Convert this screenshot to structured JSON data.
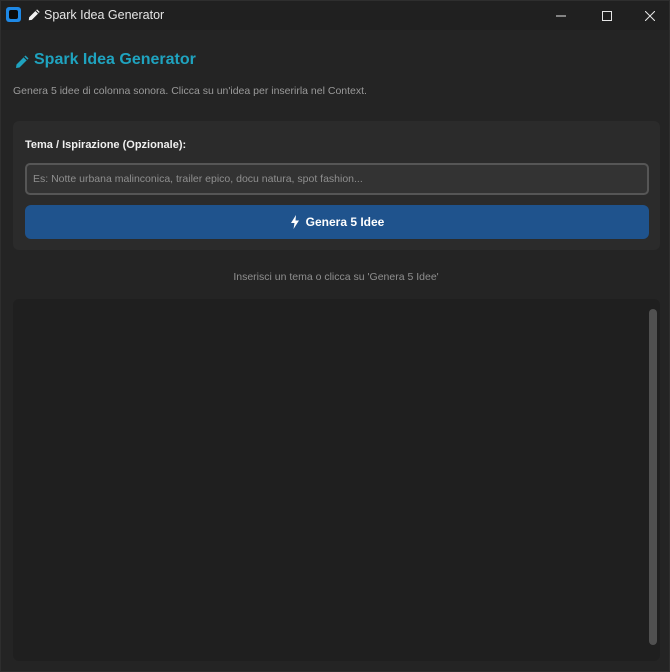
{
  "window": {
    "title": "Spark Idea Generator",
    "minimize_icon": "minimize-icon",
    "maximize_icon": "maximize-icon",
    "close_icon": "close-icon"
  },
  "header": {
    "icon": "pencil-icon",
    "title": "Spark Idea Generator",
    "subtitle": "Genera 5 idee di colonna sonora. Clicca su un'idea per inserirla nel Context."
  },
  "form": {
    "label": "Tema / Ispirazione (Opzionale):",
    "input_value": "",
    "input_placeholder": "Es: Notte urbana malinconica, trailer epico, docu natura, spot fashion...",
    "button_icon": "bolt-icon",
    "button_label": "Genera 5 Idee"
  },
  "status_text": "Inserisci un tema o clicca su 'Genera 5 Idee'",
  "results": {
    "items": []
  },
  "colors": {
    "accent": "#1fa3bf",
    "button": "#1f538d",
    "background": "#242424"
  }
}
